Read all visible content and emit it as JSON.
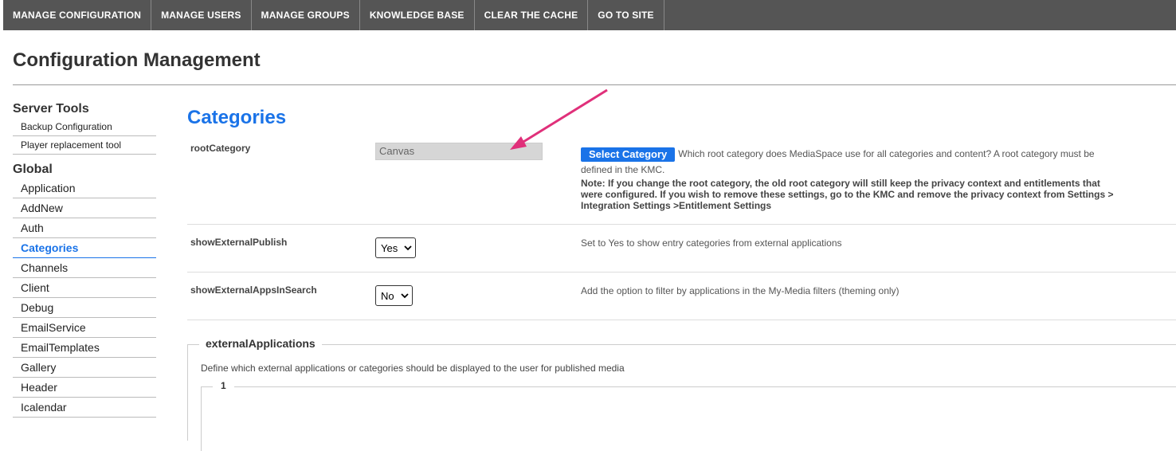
{
  "nav": {
    "items": [
      "MANAGE CONFIGURATION",
      "MANAGE USERS",
      "MANAGE GROUPS",
      "KNOWLEDGE BASE",
      "CLEAR THE CACHE",
      "GO TO SITE"
    ]
  },
  "page": {
    "title": "Configuration Management"
  },
  "sidebar": {
    "server_tools_heading": "Server Tools",
    "server_tools": [
      "Backup Configuration",
      "Player replacement tool"
    ],
    "global_heading": "Global",
    "global_items": [
      "Application",
      "AddNew",
      "Auth",
      "Categories",
      "Channels",
      "Client",
      "Debug",
      "EmailService",
      "EmailTemplates",
      "Gallery",
      "Header",
      "Icalendar"
    ],
    "active_item": "Categories"
  },
  "main": {
    "section_title": "Categories",
    "rootCategory": {
      "label": "rootCategory",
      "value": "Canvas",
      "button_label": "Select Category",
      "desc": "Which root category does MediaSpace use for all categories and content? A root category must be defined in the KMC.",
      "note": "Note: If you change the root category, the old root category will still keep the privacy context and entitlements that were configured. If you wish to remove these settings, go to the KMC and remove the privacy context from Settings > Integration Settings >Entitlement Settings"
    },
    "showExternalPublish": {
      "label": "showExternalPublish",
      "value": "Yes",
      "desc": "Set to Yes to show entry categories from external applications"
    },
    "showExternalAppsInSearch": {
      "label": "showExternalAppsInSearch",
      "value": "No",
      "desc": "Add the option to filter by applications in the My-Media filters (theming only)"
    },
    "externalApplications": {
      "legend": "externalApplications",
      "desc": "Define which external applications or categories should be displayed to the user for published media",
      "inner_legend": "1"
    }
  },
  "colors": {
    "nav_bg": "#555555",
    "accent": "#1a73e8",
    "arrow": "#e0307a"
  }
}
